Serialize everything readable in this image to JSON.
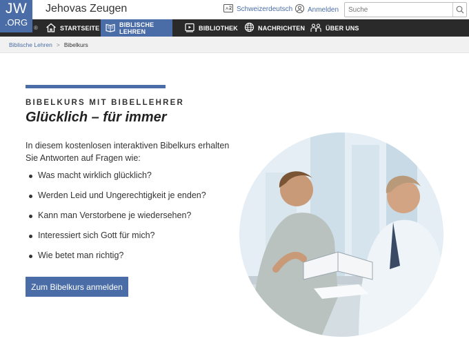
{
  "header": {
    "logo_line1": "JW",
    "logo_line2": ".ORG",
    "site_title": "Jehovas Zeugen",
    "language_label": "Schweizerdeutsch",
    "login_label": "Anmelden",
    "search_placeholder": "Suche",
    "reg_mark": "®"
  },
  "nav": {
    "items": [
      {
        "label": "STARTSEITE",
        "icon": "home-icon",
        "active": false
      },
      {
        "label": "BIBLISCHE LEHREN",
        "icon": "bible-icon",
        "active": true
      },
      {
        "label": "BIBLIOTHEK",
        "icon": "library-icon",
        "active": false
      },
      {
        "label": "NACHRICHTEN",
        "icon": "globe-icon",
        "active": false
      },
      {
        "label": "ÜBER UNS",
        "icon": "people-icon",
        "active": false
      }
    ]
  },
  "breadcrumb": {
    "parent": "Biblische Lehren",
    "separator": ">",
    "current": "Bibelkurs"
  },
  "content": {
    "kicker": "BIBELKURS MIT BIBELLEHRER",
    "headline": "Glücklich – für immer",
    "intro": "In diesem kostenlosen interaktiven Bibelkurs erhalten Sie Antworten auf Fragen wie:",
    "questions": [
      "Was macht wirklich glücklich?",
      "Werden Leid und Ungerechtigkeit je enden?",
      "Kann man Verstorbene je wiedersehen?",
      "Interessiert sich Gott für mich?",
      "Wie betet man richtig?"
    ],
    "cta_label": "Zum Bibelkurs anmelden"
  },
  "colors": {
    "brand": "#4a6da7",
    "nav_bg": "#2a2a2a",
    "breadcrumb_bg": "#f1f1f1"
  }
}
